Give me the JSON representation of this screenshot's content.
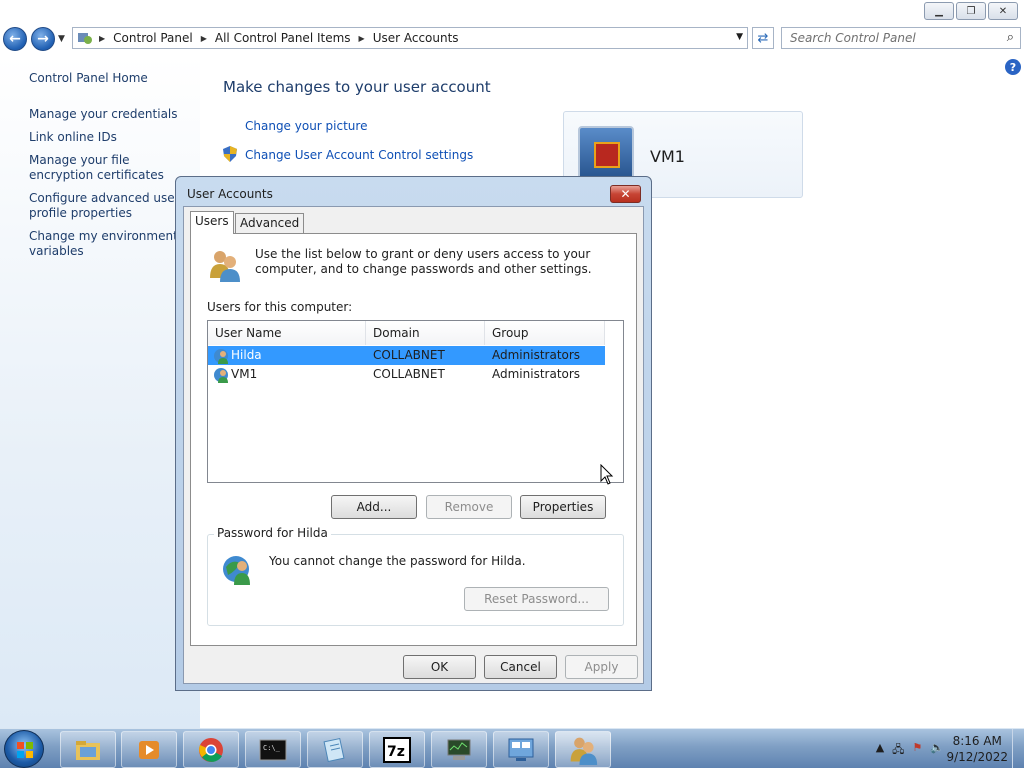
{
  "window": {
    "minimize_icon": "minimize-icon",
    "maximize_icon": "restore-icon",
    "close_icon": "close-icon"
  },
  "address": {
    "crumbs": [
      "Control Panel",
      "All Control Panel Items",
      "User Accounts"
    ],
    "search_placeholder": "Search Control Panel"
  },
  "left_nav": {
    "home": "Control Panel Home",
    "items": [
      "Manage your credentials",
      "Link online IDs",
      "Manage your file encryption certificates",
      "Configure advanced user profile properties",
      "Change my environment variables"
    ]
  },
  "main": {
    "title": "Make changes to your user account",
    "links": [
      "Change your picture",
      "Change User Account Control settings"
    ],
    "account_name": "VM1"
  },
  "dialog": {
    "title": "User Accounts",
    "tabs": [
      "Users",
      "Advanced"
    ],
    "intro": "Use the list below to grant or deny users access to your computer, and to change passwords and other settings.",
    "users_label": "Users for this computer:",
    "columns": [
      "User Name",
      "Domain",
      "Group"
    ],
    "users": [
      {
        "name": "Hilda",
        "domain": "COLLABNET",
        "group": "Administrators",
        "selected": true
      },
      {
        "name": "VM1",
        "domain": "COLLABNET",
        "group": "Administrators",
        "selected": false
      }
    ],
    "buttons": {
      "add": "Add...",
      "remove": "Remove",
      "properties": "Properties",
      "reset": "Reset Password...",
      "ok": "OK",
      "cancel": "Cancel",
      "apply": "Apply"
    },
    "password_group": "Password for Hilda",
    "password_text": "You cannot change the password for Hilda."
  },
  "taskbar": {
    "clock_time": "8:16 AM",
    "clock_date": "9/12/2022"
  }
}
